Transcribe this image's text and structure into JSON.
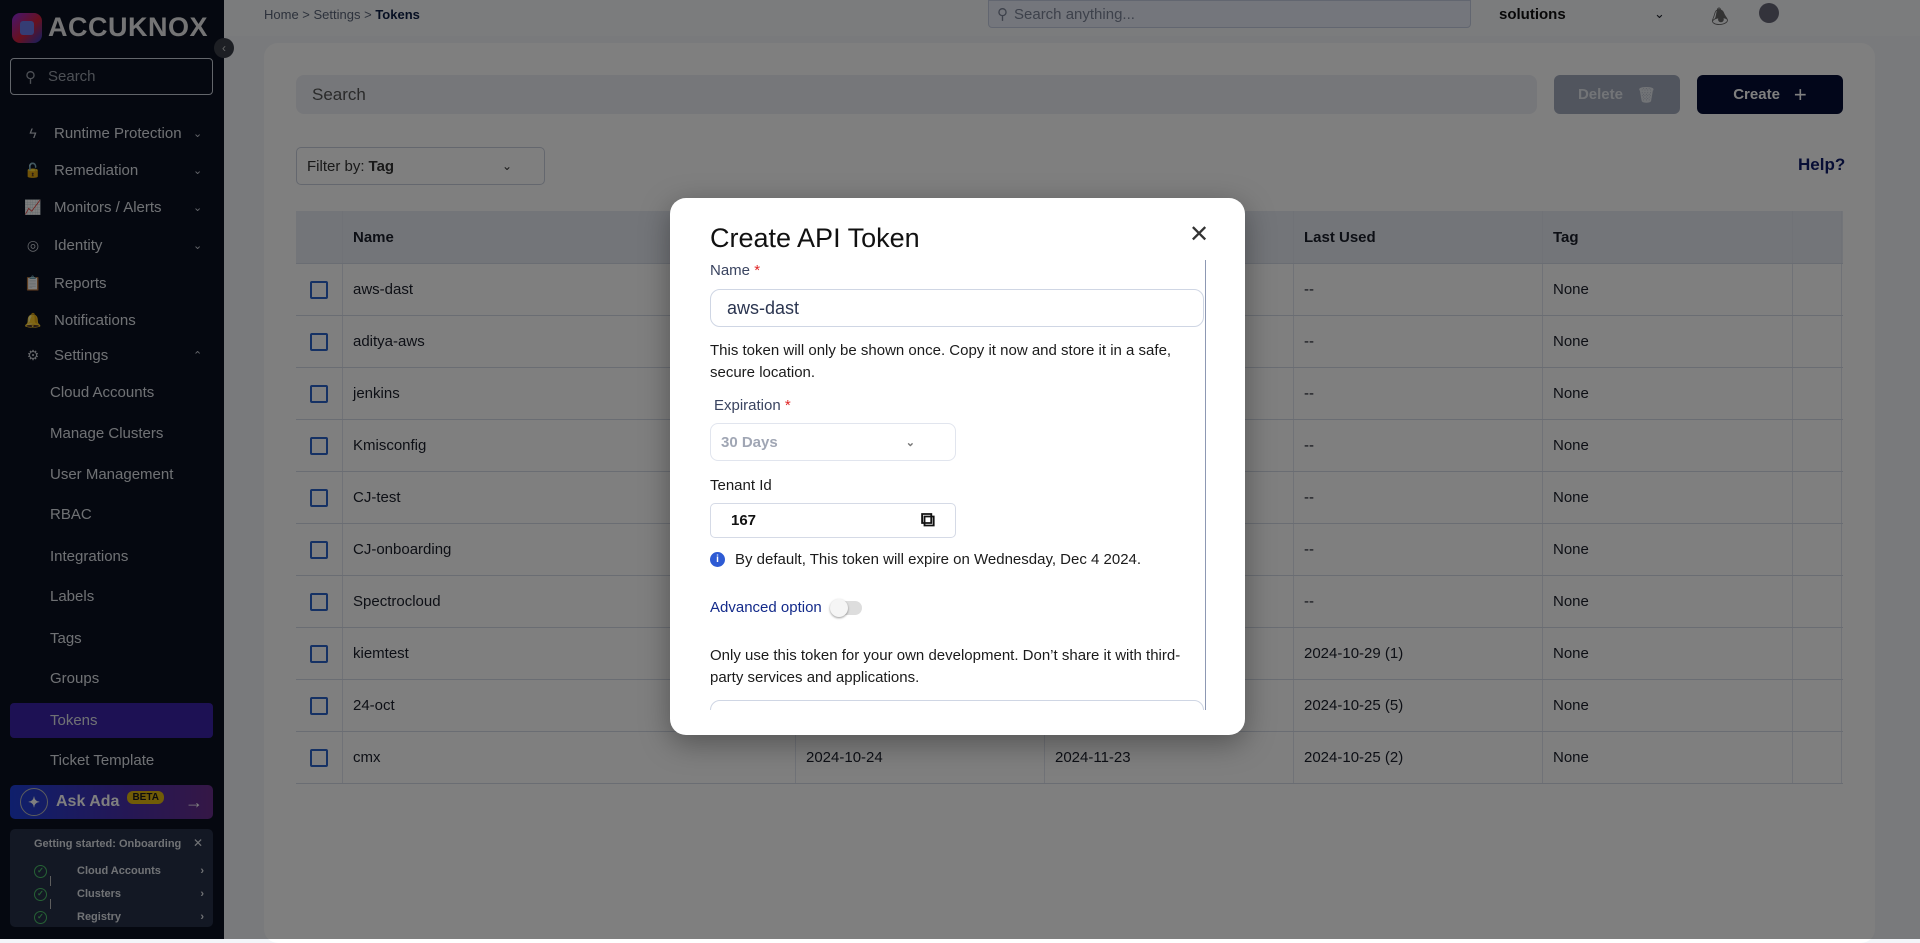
{
  "brand": {
    "name": "ACCUKNOX"
  },
  "sidebar": {
    "search_placeholder": "Search",
    "items": [
      {
        "label": "Runtime Protection",
        "icon": "lightning-icon"
      },
      {
        "label": "Remediation",
        "icon": "lock-icon"
      },
      {
        "label": "Monitors / Alerts",
        "icon": "chart-icon"
      },
      {
        "label": "Identity",
        "icon": "fingerprint-icon"
      },
      {
        "label": "Reports",
        "icon": "clipboard-icon"
      },
      {
        "label": "Notifications",
        "icon": "bell-icon"
      },
      {
        "label": "Settings",
        "icon": "gear-icon"
      }
    ],
    "settings_sub": [
      "Cloud Accounts",
      "Manage Clusters",
      "User Management",
      "RBAC",
      "Integrations",
      "Labels",
      "Tags",
      "Groups",
      "Tokens",
      "Ticket Template"
    ],
    "active": "Tokens",
    "ask_ada": {
      "label": "Ask Ada",
      "badge": "BETA"
    },
    "onboarding": {
      "title": "Getting started: Onboarding",
      "steps": [
        "Cloud Accounts",
        "Clusters",
        "Registry"
      ]
    }
  },
  "topbar": {
    "breadcrumb": [
      "Home",
      "Settings",
      "Tokens"
    ],
    "search_placeholder": "Search anything...",
    "tenant": "solutions"
  },
  "toolbar": {
    "search_placeholder": "Search",
    "delete_label": "Delete",
    "create_label": "Create",
    "filter_prefix": "Filter by:",
    "filter_value": "Tag",
    "help": "Help?"
  },
  "table": {
    "headers": [
      "Name",
      "",
      "",
      "Last Used",
      "Tag"
    ],
    "rows": [
      {
        "name": "aws-dast",
        "c2": "",
        "c3": "",
        "last_used": "--",
        "tag": "None"
      },
      {
        "name": "aditya-aws",
        "c2": "",
        "c3": "",
        "last_used": "--",
        "tag": "None"
      },
      {
        "name": "jenkins",
        "c2": "",
        "c3": "",
        "last_used": "--",
        "tag": "None"
      },
      {
        "name": "Kmisconfig",
        "c2": "",
        "c3": "",
        "last_used": "--",
        "tag": "None"
      },
      {
        "name": "CJ-test",
        "c2": "",
        "c3": "",
        "last_used": "--",
        "tag": "None"
      },
      {
        "name": "CJ-onboarding",
        "c2": "",
        "c3": "",
        "last_used": "--",
        "tag": "None"
      },
      {
        "name": "Spectrocloud",
        "c2": "",
        "c3": "",
        "last_used": "--",
        "tag": "None"
      },
      {
        "name": "kiemtest",
        "c2": "",
        "c3": "",
        "last_used": "2024-10-29 (1)",
        "tag": "None"
      },
      {
        "name": "24-oct",
        "c2": "",
        "c3": "",
        "last_used": "2024-10-25 (5)",
        "tag": "None"
      },
      {
        "name": "cmx",
        "c2": "2024-10-24",
        "c3": "2024-11-23",
        "last_used": "2024-10-25 (2)",
        "tag": "None"
      }
    ]
  },
  "modal": {
    "title": "Create API Token",
    "name_label": "Name",
    "name_value": "aws-dast",
    "notice": "This token will only be shown once. Copy it now and store it in a safe, secure location.",
    "expiration_label": "Expiration",
    "expiration_value": "30 Days",
    "tenant_label": "Tenant Id",
    "tenant_value": "167",
    "info": "By default, This token will expire on Wednesday, Dec 4 2024.",
    "advanced_label": "Advanced option",
    "advanced_enabled": false,
    "warning": "Only use this token for your own development. Don’t share it with third-party services and applications."
  },
  "colors": {
    "sidebar_bg": "#0a1020",
    "active_item": "#3b23a8",
    "create_button": "#040c34",
    "checkbox": "#2a62c9",
    "link": "#132a8a",
    "required": "#e02424"
  }
}
